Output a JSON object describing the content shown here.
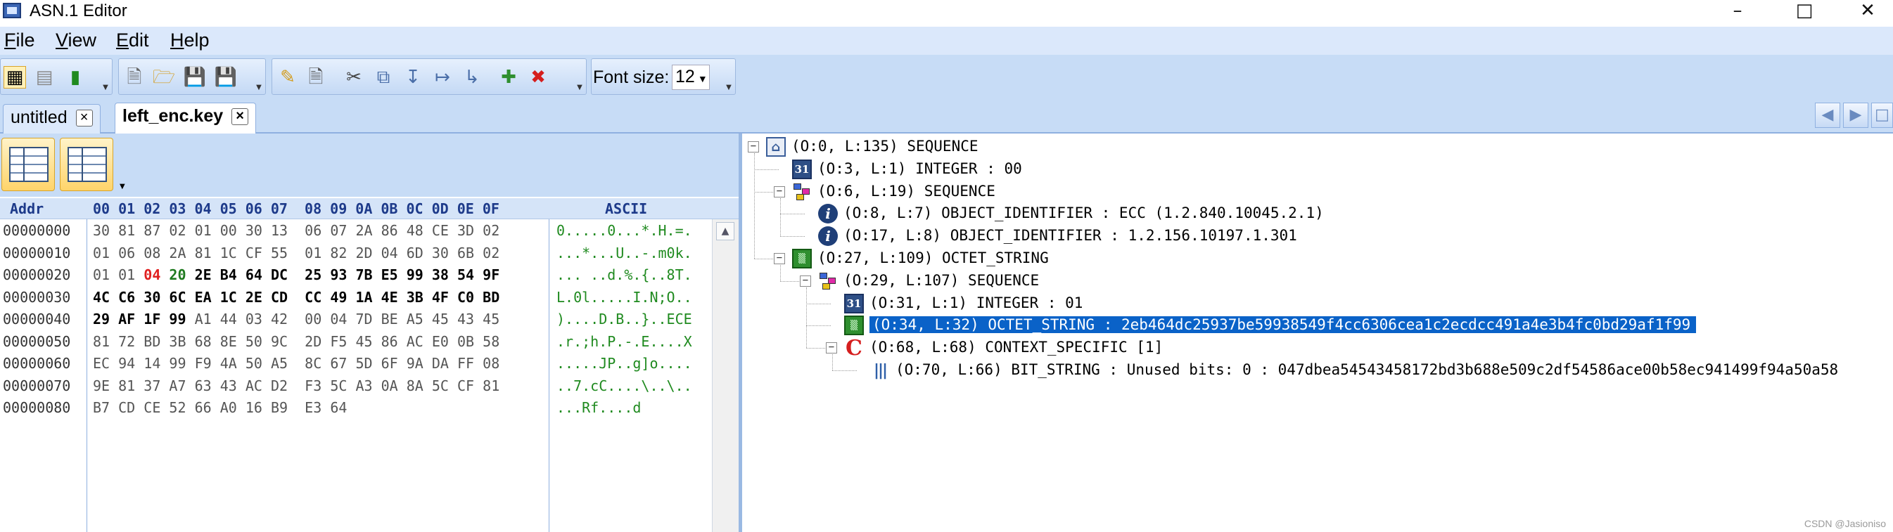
{
  "window": {
    "title": "ASN.1 Editor"
  },
  "menu": [
    {
      "id": "file",
      "first": "F",
      "rest": "ile"
    },
    {
      "id": "view",
      "first": "V",
      "rest": "iew"
    },
    {
      "id": "edit",
      "first": "E",
      "rest": "dit"
    },
    {
      "id": "help",
      "first": "H",
      "rest": "elp"
    }
  ],
  "toolbar": {
    "font_size_label": "Font size:",
    "font_size_value": "12"
  },
  "tabs": [
    {
      "label": "untitled",
      "active": false
    },
    {
      "label": "left_enc.key",
      "active": true
    }
  ],
  "hex": {
    "addr_header": "Addr",
    "col_header": "00 01 02 03 04 05 06 07  08 09 0A 0B 0C 0D 0E 0F",
    "ascii_header": "ASCII",
    "rows": [
      {
        "addr": "00000000",
        "bytes": [
          "30",
          "81",
          "87",
          "02",
          "01",
          "00",
          "30",
          "13",
          "06",
          "07",
          "2A",
          "86",
          "48",
          "CE",
          "3D",
          "02"
        ],
        "ascii": "0.....0...*.H.=."
      },
      {
        "addr": "00000010",
        "bytes": [
          "01",
          "06",
          "08",
          "2A",
          "81",
          "1C",
          "CF",
          "55",
          "01",
          "82",
          "2D",
          "04",
          "6D",
          "30",
          "6B",
          "02"
        ],
        "ascii": "...*...U..-.m0k."
      },
      {
        "addr": "00000020",
        "bytes": [
          "01",
          "01",
          "04",
          "20",
          "2E",
          "B4",
          "64",
          "DC",
          "25",
          "93",
          "7B",
          "E5",
          "99",
          "38",
          "54",
          "9F"
        ],
        "ascii": "... ..d.%.{..8T."
      },
      {
        "addr": "00000030",
        "bytes": [
          "4C",
          "C6",
          "30",
          "6C",
          "EA",
          "1C",
          "2E",
          "CD",
          "CC",
          "49",
          "1A",
          "4E",
          "3B",
          "4F",
          "C0",
          "BD"
        ],
        "ascii": "L.0l.....I.N;O.."
      },
      {
        "addr": "00000040",
        "bytes": [
          "29",
          "AF",
          "1F",
          "99",
          "A1",
          "44",
          "03",
          "42",
          "00",
          "04",
          "7D",
          "BE",
          "A5",
          "45",
          "43",
          "45"
        ],
        "ascii": ")....D.B..}..ECE"
      },
      {
        "addr": "00000050",
        "bytes": [
          "81",
          "72",
          "BD",
          "3B",
          "68",
          "8E",
          "50",
          "9C",
          "2D",
          "F5",
          "45",
          "86",
          "AC",
          "E0",
          "0B",
          "58"
        ],
        "ascii": ".r.;h.P.-.E....X"
      },
      {
        "addr": "00000060",
        "bytes": [
          "EC",
          "94",
          "14",
          "99",
          "F9",
          "4A",
          "50",
          "A5",
          "8C",
          "67",
          "5D",
          "6F",
          "9A",
          "DA",
          "FF",
          "08"
        ],
        "ascii": ".....JP..g]o...."
      },
      {
        "addr": "00000070",
        "bytes": [
          "9E",
          "81",
          "37",
          "A7",
          "63",
          "43",
          "AC",
          "D2",
          "F3",
          "5C",
          "A3",
          "0A",
          "8A",
          "5C",
          "CF",
          "81"
        ],
        "ascii": "..7.cC....\\..\\.."
      },
      {
        "addr": "00000080",
        "bytes": [
          "B7",
          "CD",
          "CE",
          "52",
          "66",
          "A0",
          "16",
          "B9",
          "E3",
          "64"
        ],
        "ascii": "...Rf....d"
      }
    ]
  },
  "tree": [
    {
      "label": "(O:0, L:135) SEQUENCE",
      "icon": "home-icon",
      "depth": 0,
      "expander": "minus"
    },
    {
      "label": "(O:3, L:1) INTEGER : 00",
      "icon": "integer-icon",
      "depth": 1,
      "expander": ""
    },
    {
      "label": "(O:6, L:19) SEQUENCE",
      "icon": "sequence-icon",
      "depth": 1,
      "expander": "minus"
    },
    {
      "label": "(O:8, L:7) OBJECT_IDENTIFIER : ECC (1.2.840.10045.2.1)",
      "icon": "info-icon",
      "depth": 2,
      "expander": ""
    },
    {
      "label": "(O:17, L:8) OBJECT_IDENTIFIER : 1.2.156.10197.1.301",
      "icon": "info-icon",
      "depth": 2,
      "expander": ""
    },
    {
      "label": "(O:27, L:109) OCTET_STRING",
      "icon": "octet-string-icon",
      "depth": 1,
      "expander": "minus"
    },
    {
      "label": "(O:29, L:107) SEQUENCE",
      "icon": "sequence-icon",
      "depth": 2,
      "expander": "minus"
    },
    {
      "label": "(O:31, L:1) INTEGER : 01",
      "icon": "integer-icon",
      "depth": 3,
      "expander": ""
    },
    {
      "label": "(O:34, L:32) OCTET_STRING : 2eb464dc25937be59938549f4cc6306cea1c2ecdcc491a4e3b4fc0bd29af1f99",
      "icon": "octet-string-icon",
      "depth": 3,
      "expander": "",
      "selected": true
    },
    {
      "label": "(O:68, L:68) CONTEXT_SPECIFIC [1]",
      "icon": "context-specific-icon",
      "depth": 3,
      "expander": "minus"
    },
    {
      "label": "(O:70, L:66) BIT_STRING : Unused bits: 0 : 047dbea54543458172bd3b688e509c2df54586ace00b58ec941499f94a50a58",
      "icon": "bit-string-icon",
      "depth": 4,
      "expander": ""
    }
  ],
  "watermark": "CSDN @Jasioniso"
}
